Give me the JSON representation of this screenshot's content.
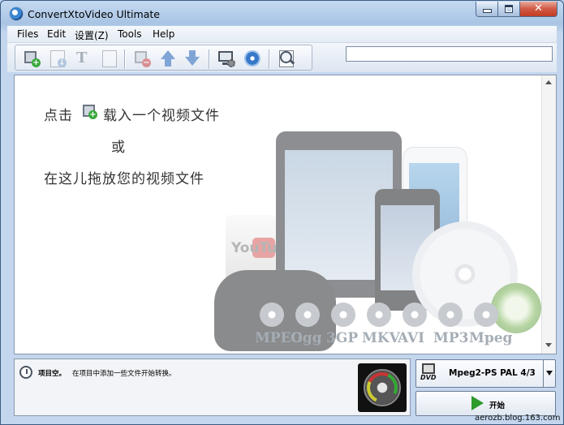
{
  "window": {
    "title": "ConvertXtoVideo Ultimate"
  },
  "menu": [
    "Files",
    "Edit",
    "设置(Z)",
    "Tools",
    "Help"
  ],
  "toolbar": {
    "buttons": [
      "add-video",
      "add-audio",
      "add-subtitle",
      "add-chapter",
      "remove",
      "move-up",
      "move-down",
      "preview-settings",
      "burn",
      "search-zoom"
    ],
    "search_value": ""
  },
  "main": {
    "hint_click": "点击",
    "hint_load": "载入一个视频文件",
    "hint_or": "或",
    "hint_drop": "在这儿拖放您的视频文件",
    "formats": [
      "MPEG",
      "Ogg",
      "3GP",
      "MKV",
      "AVI",
      "MP3",
      "Mpeg"
    ],
    "brand": "YouTube"
  },
  "status": {
    "title": "项目空。",
    "message": "在项目中添加一些文件开始转换。"
  },
  "output": {
    "icon_label": "DVD",
    "format": "Mpeg2-PS PAL 4/3",
    "start_label": "开始"
  },
  "watermark": "aerozb.blog.163.com"
}
